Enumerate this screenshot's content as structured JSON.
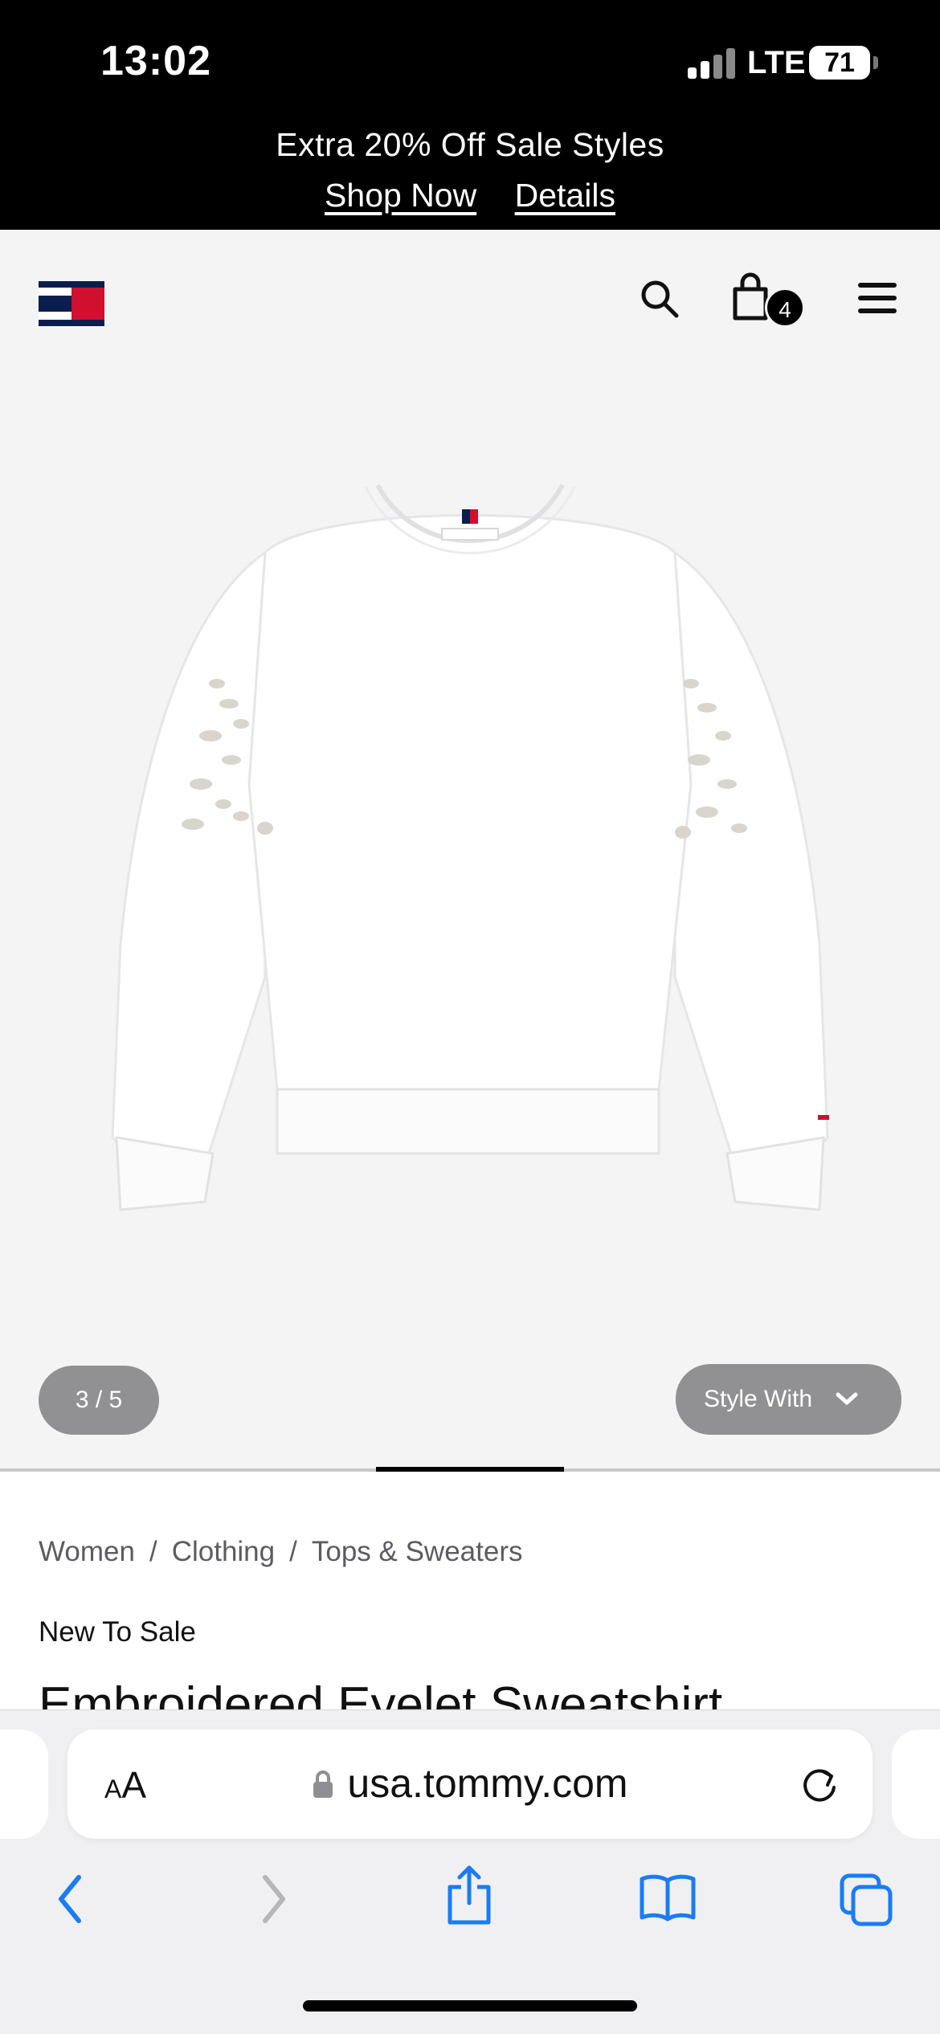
{
  "status_bar": {
    "time": "13:02",
    "network": "LTE",
    "battery": "71"
  },
  "promo": {
    "text": "Extra 20% Off Sale Styles",
    "link_shop": "Shop Now",
    "link_details": "Details"
  },
  "header": {
    "icons": [
      "flag-logo-icon",
      "search-icon",
      "shopping-bag-icon",
      "menu-icon"
    ],
    "cart_count": "4"
  },
  "gallery": {
    "counter": "3 / 5",
    "style_with_label": "Style With",
    "progress_fraction": 0.2
  },
  "breadcrumb": [
    "Women",
    "Clothing",
    "Tops & Sweaters"
  ],
  "product": {
    "tag": "New To Sale",
    "title": "Embroidered Eyelet Sweatshirt"
  },
  "browser": {
    "text_size_label_small": "A",
    "text_size_label_large": "A",
    "url": "usa.tommy.com",
    "toolbar": [
      "back-icon",
      "forward-icon",
      "share-icon",
      "bookmarks-icon",
      "tabs-icon"
    ]
  },
  "colors": {
    "brand_navy": "#0a1e4d",
    "brand_red": "#d0102e",
    "ios_blue": "#1a7cf5",
    "pill_gray": "#919193"
  }
}
